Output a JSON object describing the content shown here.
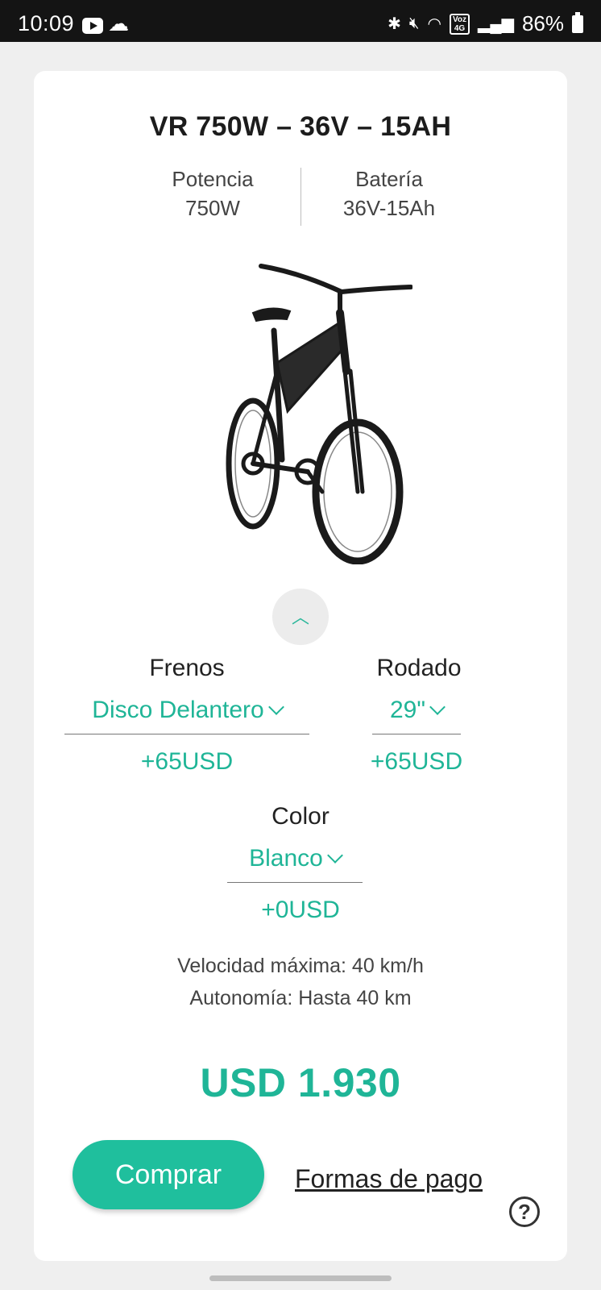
{
  "status_bar": {
    "time": "10:09",
    "battery": "86%",
    "network_badge_top": "Voz",
    "network_badge_bottom": "4G"
  },
  "product": {
    "title": "VR 750W – 36V – 15AH",
    "specs": [
      {
        "label": "Potencia",
        "value": "750W"
      },
      {
        "label": "Batería",
        "value": "36V-15Ah"
      }
    ]
  },
  "options": {
    "brakes": {
      "label": "Frenos",
      "selected": "Disco Delantero",
      "price": "+65USD"
    },
    "wheel": {
      "label": "Rodado",
      "selected": "29\"",
      "price": "+65USD"
    },
    "color": {
      "label": "Color",
      "selected": "Blanco",
      "price": "+0USD"
    }
  },
  "info": {
    "speed": "Velocidad máxima: 40 km/h",
    "range": "Autonomía: Hasta 40 km"
  },
  "price": "USD 1.930",
  "actions": {
    "buy_label": "Comprar",
    "payment_link": "Formas de pago"
  },
  "colors": {
    "accent": "#1fb597",
    "button": "#1fbf9d"
  }
}
